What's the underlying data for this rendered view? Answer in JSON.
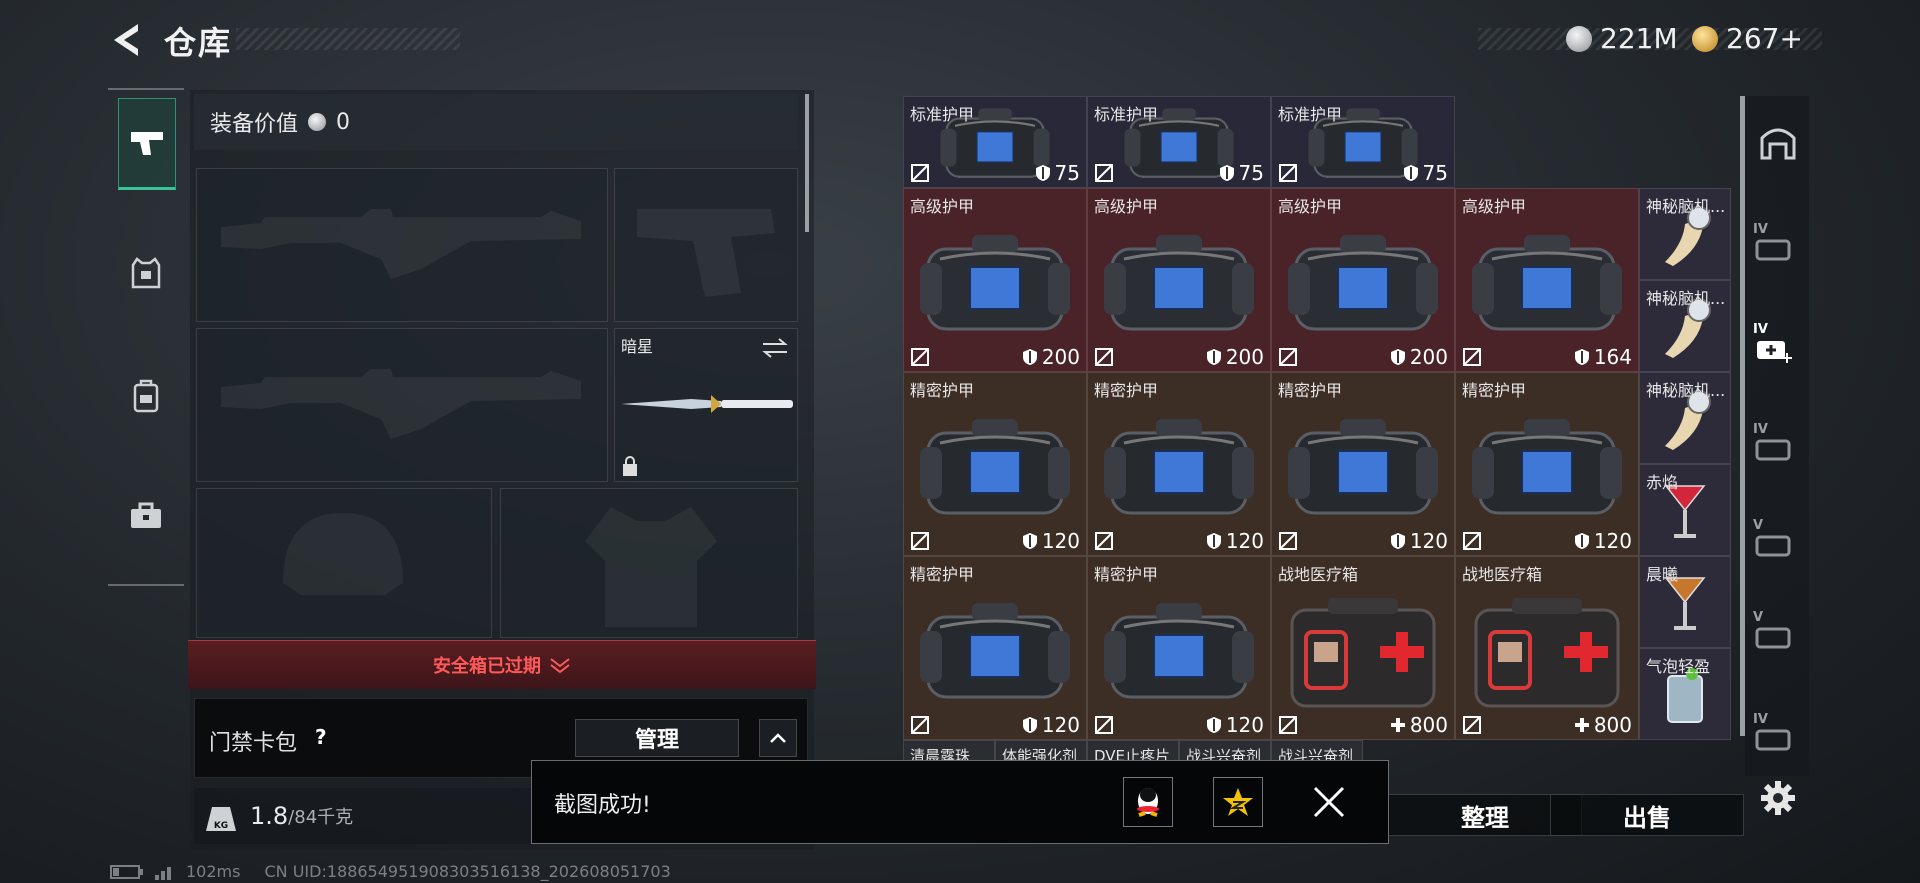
{
  "header": {
    "title": "仓库",
    "currency": [
      {
        "icon": "silver-coin-icon",
        "value": "221M"
      },
      {
        "icon": "gold-coin-icon",
        "value": "267+"
      }
    ]
  },
  "sidebar": {
    "tabs": [
      {
        "icon": "pistol-icon",
        "active": true
      },
      {
        "icon": "armor-vest-icon",
        "active": false
      },
      {
        "icon": "backpack-icon",
        "active": false
      },
      {
        "icon": "briefcase-icon",
        "active": false
      }
    ]
  },
  "equipment": {
    "value_label": "装备价值",
    "value": "0",
    "melee_name": "暗星",
    "safebox_status": "安全箱已过期",
    "keycard_label": "门禁卡包",
    "keycard_help": "?",
    "manage_button": "管理",
    "weight_value": "1.8",
    "weight_capacity": "/84千克",
    "weight_icon_text": "KG"
  },
  "inventory": {
    "items": [
      {
        "name": "标准护甲",
        "value": "75",
        "kind": "armor-std"
      },
      {
        "name": "标准护甲",
        "value": "75",
        "kind": "armor-std"
      },
      {
        "name": "标准护甲",
        "value": "75",
        "kind": "armor-std"
      },
      {
        "name": "高级护甲",
        "value": "200",
        "kind": "armor-adv"
      },
      {
        "name": "高级护甲",
        "value": "200",
        "kind": "armor-adv"
      },
      {
        "name": "高级护甲",
        "value": "200",
        "kind": "armor-adv"
      },
      {
        "name": "高级护甲",
        "value": "164",
        "kind": "armor-adv"
      },
      {
        "name": "神秘脑机...",
        "value": "",
        "kind": "neural"
      },
      {
        "name": "神秘脑机...",
        "value": "",
        "kind": "neural"
      },
      {
        "name": "精密护甲",
        "value": "120",
        "kind": "armor-prec"
      },
      {
        "name": "精密护甲",
        "value": "120",
        "kind": "armor-prec"
      },
      {
        "name": "精密护甲",
        "value": "120",
        "kind": "armor-prec"
      },
      {
        "name": "精密护甲",
        "value": "120",
        "kind": "armor-prec"
      },
      {
        "name": "神秘脑机...",
        "value": "",
        "kind": "neural"
      },
      {
        "name": "赤焰",
        "value": "",
        "kind": "drink-red"
      },
      {
        "name": "精密护甲",
        "value": "120",
        "kind": "armor-prec"
      },
      {
        "name": "精密护甲",
        "value": "120",
        "kind": "armor-prec"
      },
      {
        "name": "战地医疗箱",
        "value": "800",
        "kind": "medkit"
      },
      {
        "name": "战地医疗箱",
        "value": "800",
        "kind": "medkit"
      },
      {
        "name": "晨曦",
        "value": "",
        "kind": "drink-amber"
      },
      {
        "name": "气泡轻盈",
        "value": "",
        "kind": "drink-soda"
      }
    ],
    "partial_row": [
      "清晨露珠",
      "体能强化剂",
      "DVE止疼片",
      "战斗兴奋剂",
      "战斗兴奋剂"
    ]
  },
  "actions": {
    "sort_button": "整理",
    "sell_button": "出售"
  },
  "toast": {
    "message": "截图成功!"
  },
  "status_bar": {
    "ping": "102ms",
    "uid": "CN UID:18865495190830351613​8_202608051703"
  },
  "colors": {
    "accent_green": "#38c39a",
    "alert_red": "#ff5a5a",
    "armor_adv_bg": "#4a2328",
    "armor_prec_bg": "#3d2e25",
    "armor_std_bg": "#282838"
  }
}
